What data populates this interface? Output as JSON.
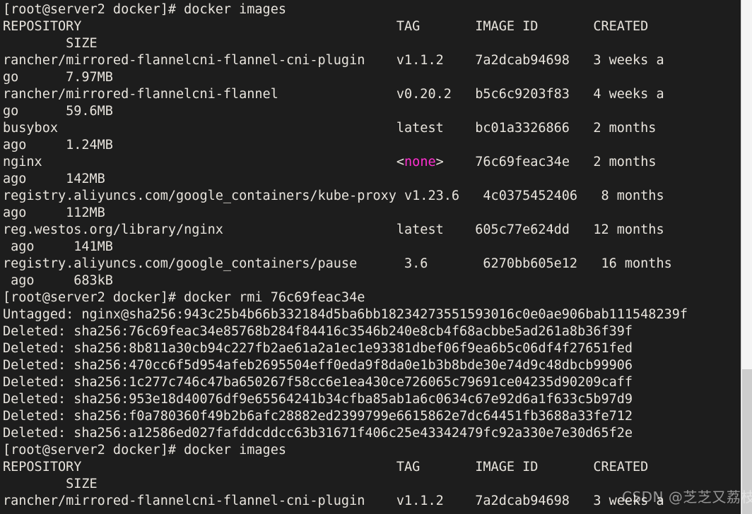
{
  "terminal": {
    "background_color": "#1d1d1d",
    "foreground_color": "#e8e4dd",
    "magenta_color": "#ff2fd0",
    "lines": [
      {
        "id": "l01",
        "text": "[root@server2 docker]# docker images"
      },
      {
        "id": "l02",
        "text": "REPOSITORY                                        TAG       IMAGE ID       CREATED"
      },
      {
        "id": "l03",
        "text": "        SIZE"
      },
      {
        "id": "l04",
        "text": "rancher/mirrored-flannelcni-flannel-cni-plugin    v1.1.2    7a2dcab94698   3 weeks a"
      },
      {
        "id": "l05",
        "text": "go      7.97MB"
      },
      {
        "id": "l06",
        "text": "rancher/mirrored-flannelcni-flannel               v0.20.2   b5c6c9203f83   4 weeks a"
      },
      {
        "id": "l07",
        "text": "go      59.6MB"
      },
      {
        "id": "l08",
        "text": "busybox                                           latest    bc01a3326866   2 months"
      },
      {
        "id": "l09",
        "text": "ago     1.24MB"
      },
      {
        "id": "l10",
        "text": "nginx                                             <none>    76c69feac34e   2 months",
        "magenta_token": "none"
      },
      {
        "id": "l11",
        "text": "ago     142MB"
      },
      {
        "id": "l12",
        "text": "registry.aliyuncs.com/google_containers/kube-proxy v1.23.6   4c0375452406   8 months"
      },
      {
        "id": "l13",
        "text": "ago     112MB"
      },
      {
        "id": "l14",
        "text": "reg.westos.org/library/nginx                      latest    605c77e624dd   12 months"
      },
      {
        "id": "l15",
        "text": " ago     141MB"
      },
      {
        "id": "l16",
        "text": "registry.aliyuncs.com/google_containers/pause      3.6       6270bb605e12   16 months"
      },
      {
        "id": "l17",
        "text": " ago     683kB"
      },
      {
        "id": "l18",
        "text": "[root@server2 docker]# docker rmi 76c69feac34e"
      },
      {
        "id": "l19",
        "text": "Untagged: nginx@sha256:943c25b4b66b332184d5ba6bb18234273551593016c0e0ae906bab111548239f"
      },
      {
        "id": "l20",
        "text": "Deleted: sha256:76c69feac34e85768b284f84416c3546b240e8cb4f68acbbe5ad261a8b36f39f"
      },
      {
        "id": "l21",
        "text": "Deleted: sha256:8b811a30cb94c227fb2ae61a2a1ec1e93381dbef06f9ea6b5c06df4f27651fed"
      },
      {
        "id": "l22",
        "text": "Deleted: sha256:470cc6f5d954afeb2695504eff0eda9f8da0e1b3b8bde30e74d9c48dbcb99906"
      },
      {
        "id": "l23",
        "text": "Deleted: sha256:1c277c746c47ba650267f58cc6e1ea430ce726065c79691ce04235d90209caff"
      },
      {
        "id": "l24",
        "text": "Deleted: sha256:953e18d40076df9e65564241b34cfba85ab1a6c0634c67e92d6a1f633c5b97d9"
      },
      {
        "id": "l25",
        "text": "Deleted: sha256:f0a780360f49b2b6afc28882ed2399799e6615862e7dc64451fb3688a33fe712"
      },
      {
        "id": "l26",
        "text": "Deleted: sha256:a12586ed027fafddcddcc63b31671f406c25e43342479fc92a330e7e30d65f2e"
      },
      {
        "id": "l27",
        "text": "[root@server2 docker]# docker images"
      },
      {
        "id": "l28",
        "text": "REPOSITORY                                        TAG       IMAGE ID       CREATED"
      },
      {
        "id": "l29",
        "text": "        SIZE"
      },
      {
        "id": "l30",
        "text": "rancher/mirrored-flannelcni-flannel-cni-plugin    v1.1.2    7a2dcab94698   3 weeks a"
      }
    ]
  },
  "scrollbar": {
    "orientation": "vertical",
    "track_color": "#f0f0f0",
    "thumb_color": "#cdcdcd"
  },
  "watermark": {
    "text": "CSDN @芝芝又荔枝"
  }
}
